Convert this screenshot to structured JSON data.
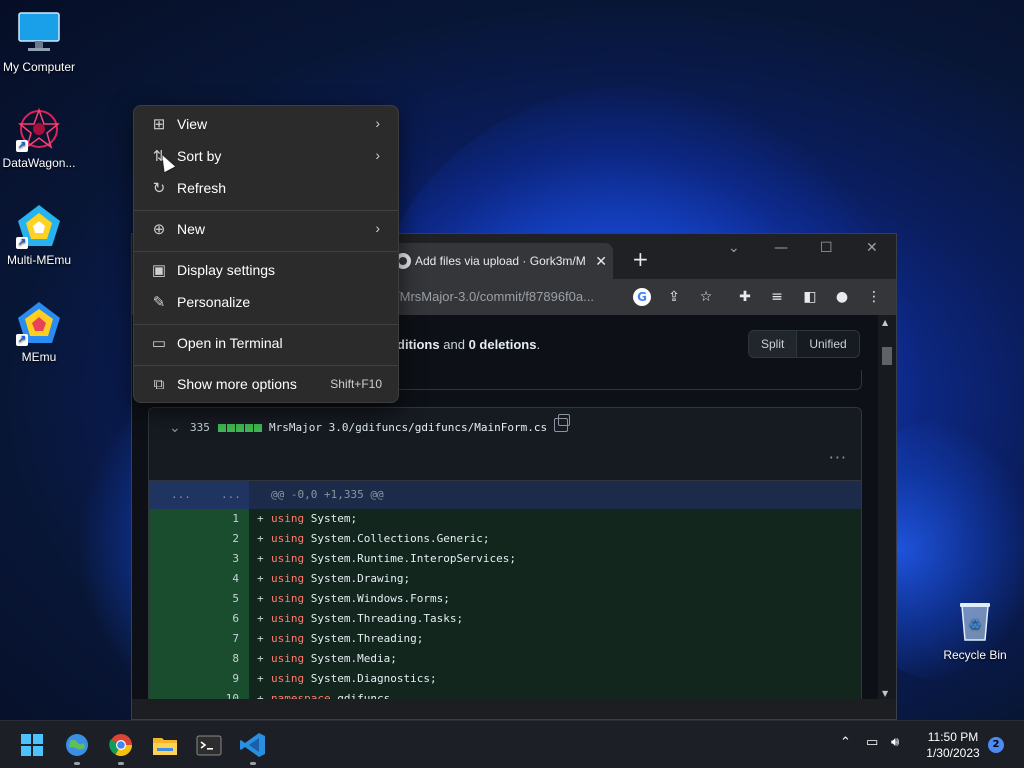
{
  "desktop": {
    "icons": [
      {
        "label": "My Computer"
      },
      {
        "label": "DataWagon..."
      },
      {
        "label": "Multi-MEmu"
      },
      {
        "label": "MEmu"
      }
    ],
    "recycle_bin": "Recycle Bin"
  },
  "context_menu": {
    "items": [
      {
        "label": "View",
        "icon": "grid-icon",
        "submenu": true
      },
      {
        "label": "Sort by",
        "icon": "sort-icon",
        "submenu": true
      },
      {
        "label": "Refresh",
        "icon": "refresh-icon"
      },
      {
        "label": "New",
        "icon": "plus-circle-icon",
        "submenu": true
      },
      {
        "label": "Display settings",
        "icon": "display-icon"
      },
      {
        "label": "Personalize",
        "icon": "pen-icon"
      },
      {
        "label": "Open in Terminal",
        "icon": "terminal-icon"
      },
      {
        "label": "Show more options",
        "icon": "more-options-icon",
        "shortcut": "Shift+F10"
      }
    ]
  },
  "browser": {
    "tab_title": "Add files via upload · Gork3m/M",
    "url": "/MrsMajor-3.0/commit/f87896f0a...",
    "summary": {
      "text1": "ditions",
      "text2": "and",
      "deletions": "0 deletions",
      "period": "."
    },
    "view_split": "Split",
    "view_unified": "Unified",
    "file": {
      "count": "335",
      "path": "MrsMajor 3.0/gdifuncs/gdifuncs/MainForm.cs",
      "hunk_left": "...",
      "hunk_right": "...",
      "hunk_header": "@@ -0,0 +1,335 @@"
    },
    "lines": [
      {
        "n": "1",
        "kw": "using",
        "rest": " System;"
      },
      {
        "n": "2",
        "kw": "using",
        "rest": " System.Collections.Generic;"
      },
      {
        "n": "3",
        "kw": "using",
        "rest": " System.Runtime.InteropServices;"
      },
      {
        "n": "4",
        "kw": "using",
        "rest": " System.Drawing;"
      },
      {
        "n": "5",
        "kw": "using",
        "rest": " System.Windows.Forms;"
      },
      {
        "n": "6",
        "kw": "using",
        "rest": " System.Threading.Tasks;"
      },
      {
        "n": "7",
        "kw": "using",
        "rest": " System.Threading;"
      },
      {
        "n": "8",
        "kw": "using",
        "rest": " System.Media;"
      },
      {
        "n": "9",
        "kw": "using",
        "rest": " System.Diagnostics;"
      },
      {
        "n": "10",
        "kw": "namespace",
        "rest": " gdifuncs"
      }
    ]
  },
  "taskbar": {
    "time": "11:50 PM",
    "date": "1/30/2023",
    "notification_count": "2"
  }
}
